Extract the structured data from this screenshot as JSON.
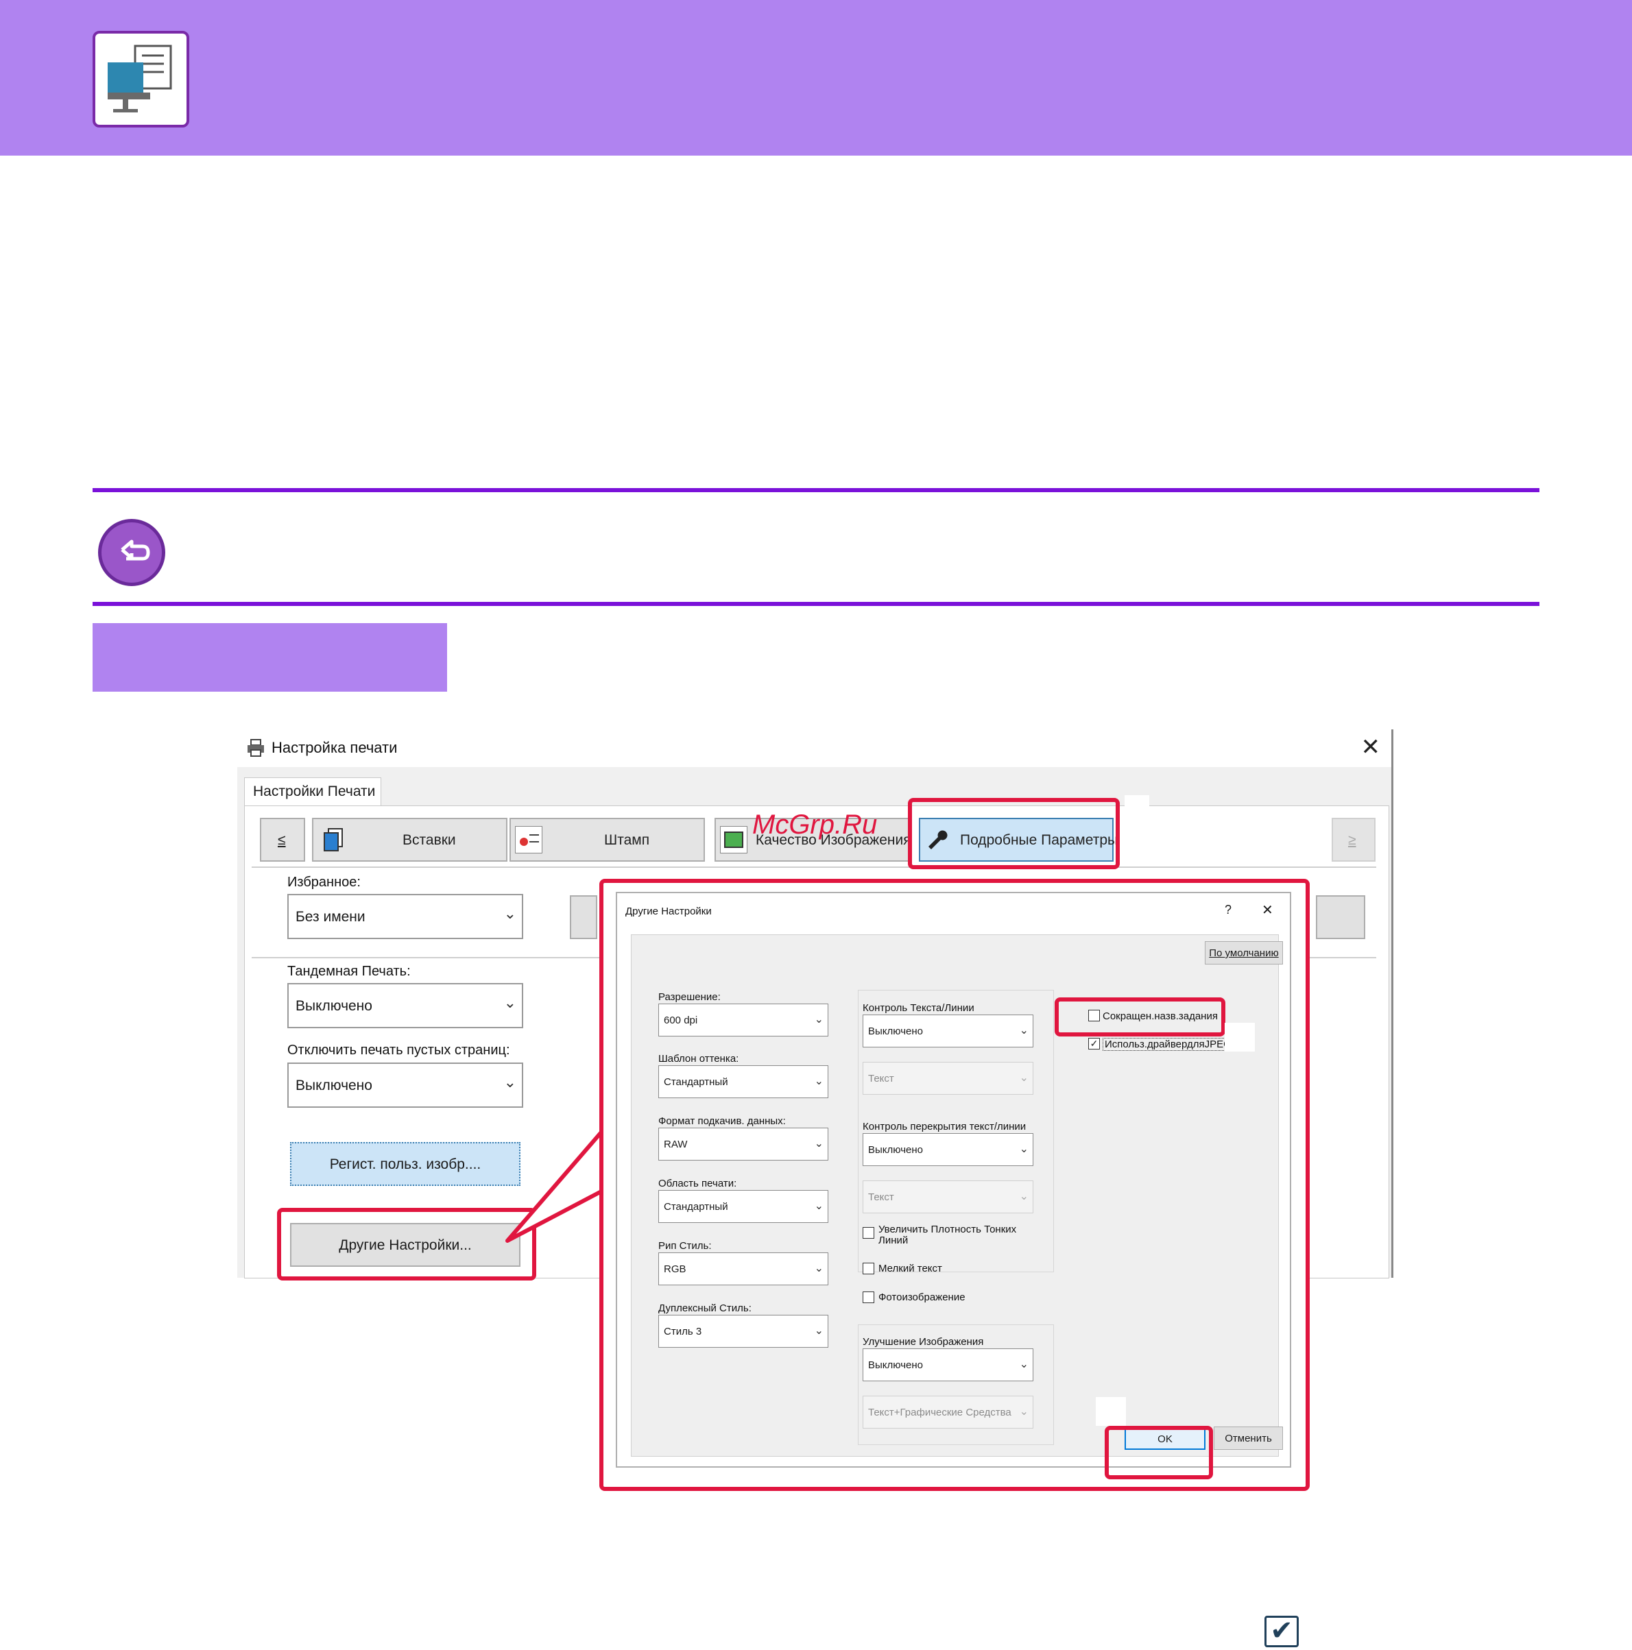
{
  "colors": {
    "banner": "#b083f0",
    "accent_line": "#7a11d9",
    "highlight": "#e0163f"
  },
  "icons": {
    "banner": "print-monitor-icon",
    "back": "back-arrow-icon",
    "printer": "printer-icon",
    "wrench": "wrench-icon",
    "bottom": "checkmark-icon"
  },
  "watermark": "McGrp.Ru",
  "main_dialog": {
    "title": "Настройка печати",
    "close": "✕",
    "tab": "Настройки Печати",
    "nav": {
      "prev": "≤",
      "next": "≥",
      "tabs": [
        "Вставки",
        "Штамп",
        "Качество Изображения",
        "Подробные Параметры"
      ]
    },
    "favorites_label": "Избранное:",
    "favorites_value": "Без имени",
    "tandem_label": "Тандемная Печать:",
    "tandem_value": "Выключено",
    "blank_pages_label": "Отключить печать пустых страниц:",
    "blank_pages_value": "Выключено",
    "register_button": "Регист. польз. изобр....",
    "other_settings_button": "Другие Настройки..."
  },
  "other_dialog": {
    "title": "Другие Настройки",
    "help": "?",
    "close": "✕",
    "default_button": "По умолчанию",
    "left_fields": [
      {
        "label": "Разрешение:",
        "value": "600 dpi"
      },
      {
        "label": "Шаблон оттенка:",
        "value": "Стандартный"
      },
      {
        "label": "Формат подкачив. данных:",
        "value": "RAW"
      },
      {
        "label": "Область печати:",
        "value": "Стандартный"
      },
      {
        "label": "Рип Стиль:",
        "value": "RGB"
      },
      {
        "label": "Дуплексный Стиль:",
        "value": "Стиль 3"
      }
    ],
    "text_line_control_label": "Контроль Текста/Линии",
    "text_line_control_value": "Выключено",
    "text_line_control_sub": "Текст",
    "overlap_control_label": "Контроль перекрытия текст/линии",
    "overlap_control_value": "Выключено",
    "overlap_control_sub": "Текст",
    "checkbox_thin_lines": "Увеличить Плотность Тонких Линий",
    "checkbox_small_text": "Мелкий текст",
    "checkbox_photo": "Фотоизображение",
    "image_enhance_label": "Улучшение Изображения",
    "image_enhance_value": "Выключено",
    "image_enhance_sub": "Текст+Графические Средства",
    "checkbox_short_job_name": "Сокращен.назв.задания",
    "checkbox_jpeg": "Использ.драйвердляJPEG",
    "ok": "OK",
    "cancel": "Отменить"
  }
}
